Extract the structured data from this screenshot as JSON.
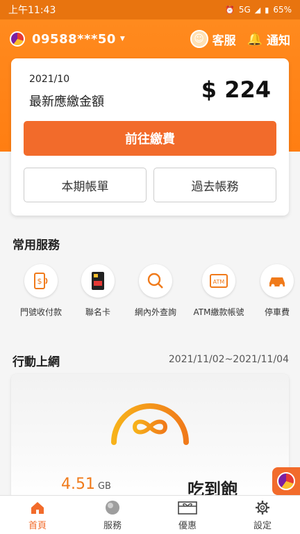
{
  "status_bar": {
    "time": "上午11:43",
    "network": "5G",
    "battery": "65%"
  },
  "header": {
    "phone_number": "09588***50",
    "customer_service": "客服",
    "notifications": "通知"
  },
  "bill": {
    "period": "2021/10",
    "label": "最新應繳金額",
    "amount": "$ 224",
    "pay_button": "前往繳費",
    "current_bill_button": "本期帳單",
    "past_bills_button": "過去帳務"
  },
  "services": {
    "title": "常用服務",
    "items": [
      {
        "label": "門號收付款",
        "icon": "payment-icon"
      },
      {
        "label": "聯名卡",
        "icon": "card-icon"
      },
      {
        "label": "網內外查詢",
        "icon": "search-icon"
      },
      {
        "label": "ATM繳款帳號",
        "icon": "atm-icon"
      },
      {
        "label": "停車費",
        "icon": "car-icon"
      }
    ]
  },
  "mobile": {
    "title": "行動上網",
    "date_range": "2021/11/02~2021/11/04",
    "usage_value": "4.51",
    "usage_unit": "GB",
    "plan_label": "吃到飽"
  },
  "tabs": [
    {
      "label": "首頁",
      "icon": "home-icon",
      "active": true
    },
    {
      "label": "服務",
      "icon": "services-icon",
      "active": false
    },
    {
      "label": "優惠",
      "icon": "gift-icon",
      "active": false
    },
    {
      "label": "設定",
      "icon": "gear-icon",
      "active": false
    }
  ],
  "colors": {
    "brand_orange": "#f26b2b",
    "accent_orange": "#ff8a1e"
  }
}
